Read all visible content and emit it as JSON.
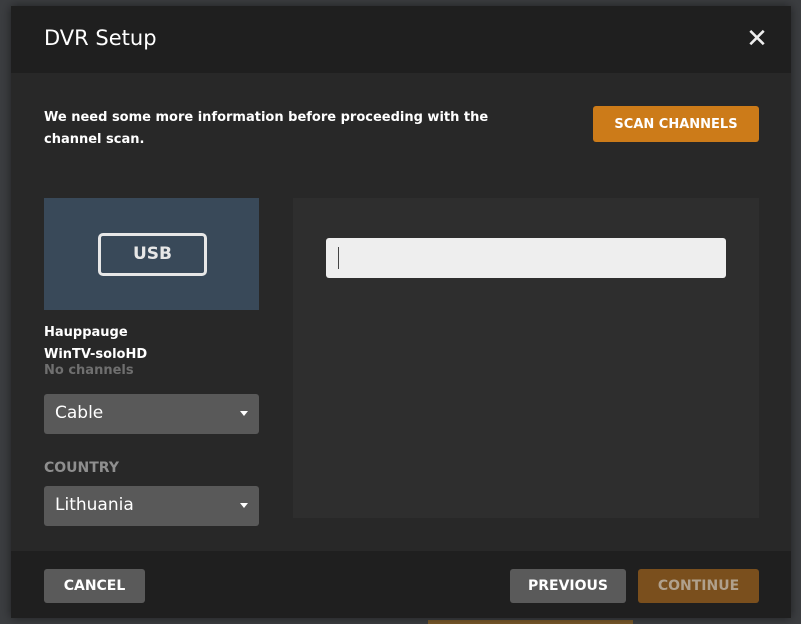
{
  "dialog": {
    "title": "DVR Setup",
    "close_icon": "close-icon"
  },
  "body": {
    "info_text": "We need some more information before proceeding with the channel scan.",
    "scan_button_label": "SCAN CHANNELS",
    "device": {
      "badge": "USB",
      "name_line1": "Hauppauge",
      "name_line2": "WinTV-soloHD",
      "channels": "No channels"
    },
    "source_select": {
      "value": "Cable"
    },
    "country_label": "COUNTRY",
    "country_select": {
      "value": "Lithuania"
    },
    "search_input": {
      "value": "",
      "placeholder": ""
    }
  },
  "footer": {
    "cancel_label": "CANCEL",
    "previous_label": "PREVIOUS",
    "continue_label": "CONTINUE"
  },
  "colors": {
    "accent": "#cc7b19",
    "accent_disabled": "#7a4f1d",
    "device_tile": "#394959",
    "button_gray": "#5a5a5a",
    "header_bg": "#1f1f1f",
    "body_bg": "#282828"
  }
}
